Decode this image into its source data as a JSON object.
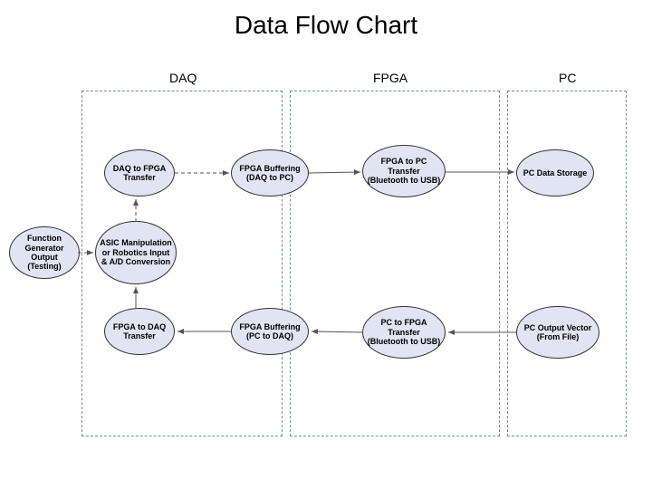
{
  "title": "Data Flow Chart",
  "groups": {
    "daq": "DAQ",
    "fpga": "FPGA",
    "pc": "PC"
  },
  "nodes": {
    "fg": "Function Generator Output (Testing)",
    "asic": "ASIC Manipulation or Robotics Input & A/D Conversion",
    "daq2fpga": "DAQ to FPGA Transfer",
    "fpga2daq": "FPGA to DAQ Transfer",
    "buf_daq_pc": "FPGA Buffering (DAQ to PC)",
    "buf_pc_daq": "FPGA Buffering (PC to DAQ)",
    "fpga2pc": "FPGA to PC Transfer (Bluetooth to USB)",
    "pc2fpga": "PC to FPGA Transfer (Bluetooth to USB)",
    "pc_store": "PC Data Storage",
    "pc_out": "PC Output Vector (From File)"
  }
}
